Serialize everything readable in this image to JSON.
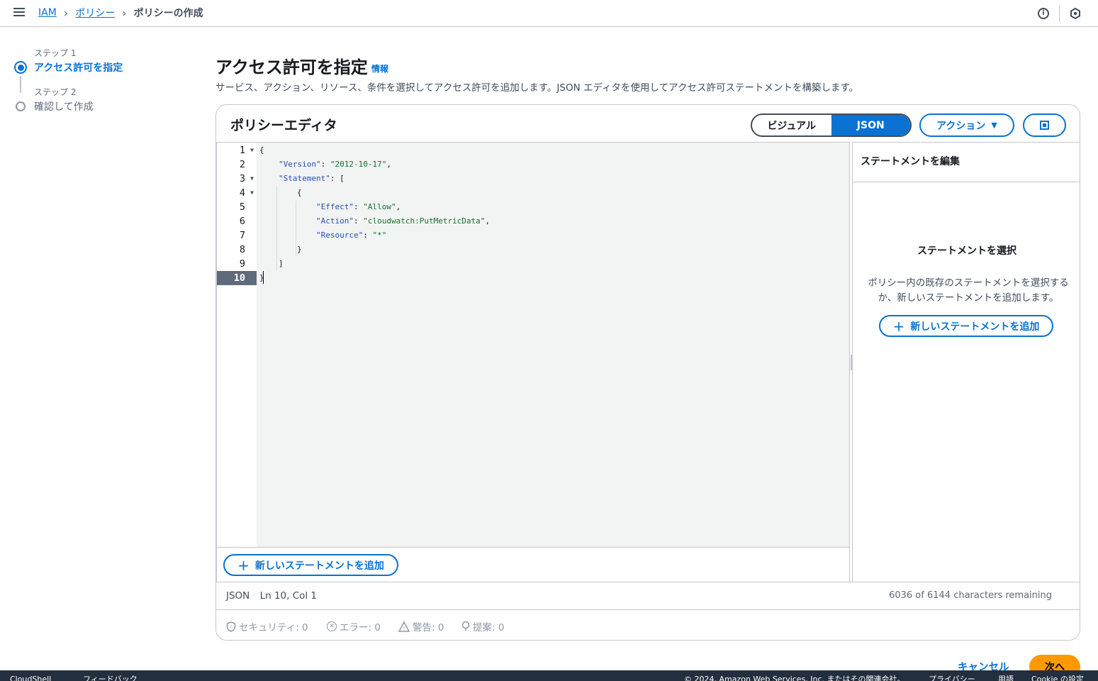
{
  "header": {
    "breadcrumbs": [
      "IAM",
      "ポリシー",
      "ポリシーの作成"
    ]
  },
  "steps": [
    {
      "label": "ステップ 1",
      "title": "アクセス許可を指定",
      "active": true
    },
    {
      "label": "ステップ 2",
      "title": "確認して作成",
      "active": false
    }
  ],
  "page": {
    "title": "アクセス許可を指定",
    "info": "情報",
    "description": "サービス、アクション、リソース、条件を選択してアクセス許可を追加します。JSON エディタを使用してアクセス許可ステートメントを構築します。"
  },
  "editor": {
    "title": "ポリシーエディタ",
    "modes": [
      "ビジュアル",
      "JSON"
    ],
    "selected_mode": "JSON",
    "actions_label": "アクション",
    "code_lines": [
      "{",
      "\"Version\": \"2012-10-17\",",
      "\"Statement\": [",
      "{",
      "\"Effect\": \"Allow\",",
      "\"Action\": \"cloudwatch:PutMetricData\",",
      "\"Resource\": \"*\"",
      "}",
      "]",
      "}"
    ],
    "line_numbers": [
      "1",
      "2",
      "3",
      "4",
      "5",
      "6",
      "7",
      "8",
      "9",
      "10"
    ],
    "active_line": 10,
    "add_statement": "新しいステートメントを追加"
  },
  "side_panel": {
    "header": "ステートメントを編集",
    "empty_title": "ステートメントを選択",
    "empty_desc": "ポリシー内の既存のステートメントを選択するか、新しいステートメントを追加します。",
    "add_statement": "新しいステートメントを追加"
  },
  "status": {
    "mode": "JSON",
    "position": "Ln 10, Col 1",
    "remaining": "6036 of 6144 characters remaining"
  },
  "validation": {
    "security": "セキュリティ: 0",
    "errors": "エラー: 0",
    "warnings": "警告: 0",
    "suggestions": "提案: 0"
  },
  "footer_actions": {
    "cancel": "キャンセル",
    "next": "次へ"
  },
  "console": {
    "cloudshell": "CloudShell",
    "feedback": "フィードバック",
    "copyright": "© 2024, Amazon Web Services, Inc. またはその関連会社。",
    "privacy": "プライバシー",
    "terms": "用語",
    "cookie": "Cookie の設定"
  },
  "colors": {
    "accent": "#0972d3",
    "primary_button": "#ff9900",
    "console_bar": "#232f3e"
  }
}
